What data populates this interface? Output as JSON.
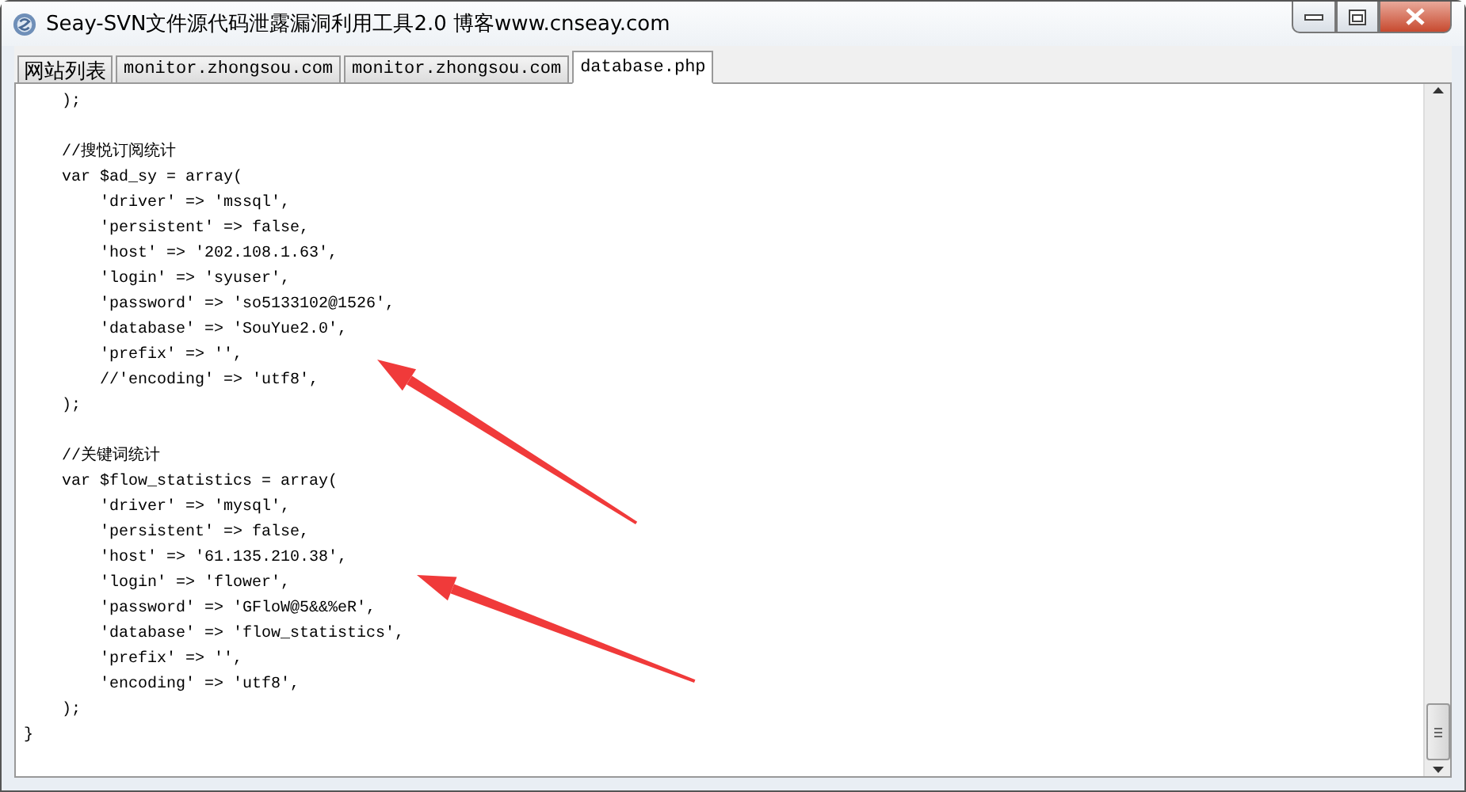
{
  "window": {
    "title": "Seay-SVN文件源代码泄露漏洞利用工具2.0  博客www.cnseay.com"
  },
  "tabs": [
    {
      "label": "网站列表",
      "selected": false,
      "kind": "cjk"
    },
    {
      "label": "monitor.zhongsou.com",
      "selected": false,
      "kind": "mono"
    },
    {
      "label": "monitor.zhongsou.com",
      "selected": false,
      "kind": "mono"
    },
    {
      "label": "database.php",
      "selected": true,
      "kind": "mono"
    }
  ],
  "code_blocks": [
    {
      "lines": [
        "    );"
      ]
    },
    {
      "lines": [
        "    //搜悦订阅统计",
        "    var $ad_sy = array(",
        "        'driver' => 'mssql',",
        "        'persistent' => false,",
        "        'host' => '202.108.1.63',",
        "        'login' => 'syuser',",
        "        'password' => 'so5133102@1526',",
        "        'database' => 'SouYue2.0',",
        "        'prefix' => '',",
        "        //'encoding' => 'utf8',",
        "    );"
      ]
    },
    {
      "lines": [
        "    //关键词统计",
        "    var $flow_statistics = array(",
        "        'driver' => 'mysql',",
        "        'persistent' => false,",
        "        'host' => '61.135.210.38',",
        "        'login' => 'flower',",
        "        'password' => 'GFloW@5&&%eR',",
        "        'database' => 'flow_statistics',",
        "        'prefix' => '',",
        "        'encoding' => 'utf8',",
        "    );",
        "}"
      ]
    }
  ],
  "annotations": [
    {
      "kind": "arrow"
    },
    {
      "kind": "arrow"
    }
  ]
}
